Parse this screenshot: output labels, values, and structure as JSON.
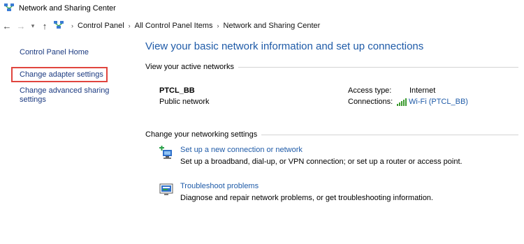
{
  "window": {
    "title": "Network and Sharing Center"
  },
  "address_bar": {
    "breadcrumbs": [
      "Control Panel",
      "All Control Panel Items",
      "Network and Sharing Center"
    ]
  },
  "sidebar": {
    "home": "Control Panel Home",
    "items": [
      {
        "label": "Change adapter settings",
        "highlighted": true
      },
      {
        "label": "Change advanced sharing settings",
        "highlighted": false
      }
    ]
  },
  "main": {
    "title": "View your basic network information and set up connections",
    "active_networks_heading": "View your active networks",
    "network": {
      "name": "PTCL_BB",
      "type": "Public network",
      "access_type_label": "Access type:",
      "access_type_value": "Internet",
      "connections_label": "Connections:",
      "connections_value": "Wi-Fi (PTCL_BB)"
    },
    "change_settings_heading": "Change your networking settings",
    "tasks": [
      {
        "link": "Set up a new connection or network",
        "description": "Set up a broadband, dial-up, or VPN connection; or set up a router or access point.",
        "icon": "new-connection-icon"
      },
      {
        "link": "Troubleshoot problems",
        "description": "Diagnose and repair network problems, or get troubleshooting information.",
        "icon": "troubleshoot-icon"
      }
    ]
  },
  "colors": {
    "link": "#1f5ba8",
    "sidebar_link": "#1b3a80",
    "highlight_border": "#e0453e",
    "wifi_bars": "#3c9a2f"
  }
}
